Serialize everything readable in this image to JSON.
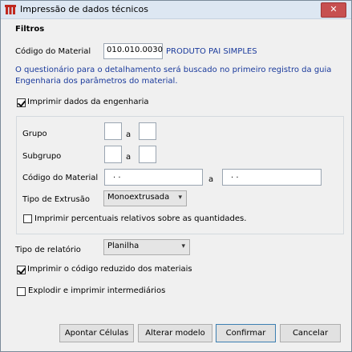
{
  "window": {
    "title": "Impressão de dados técnicos",
    "close_glyph": "✕"
  },
  "filters": {
    "section_title": "Filtros",
    "material_code_label": "Código do Material",
    "material_code_value": "010.010.0030",
    "material_name": "PRODUTO PAI SIMPLES",
    "info_line1": "O questionário para o detalhamento será buscado no primeiro registro da guia",
    "info_line2": "Engenharia dos parâmetros do material.",
    "print_engineering_label": "Imprimir dados da engenharia",
    "print_engineering_checked": true
  },
  "engineering": {
    "group_label": "Grupo",
    "group_from": "",
    "group_to": "",
    "subgroup_label": "Subgrupo",
    "subgroup_from": "",
    "subgroup_to": "",
    "range_sep": "a",
    "material_range_label": "Código do Material",
    "material_from": " .   .",
    "material_to": " .   .",
    "extrusion_label": "Tipo de Extrusão",
    "extrusion_value": "Monoextrusada",
    "percent_label": "Imprimir percentuais relativos sobre as quantidades.",
    "percent_checked": false
  },
  "report": {
    "type_label": "Tipo de relatório",
    "type_value": "Planilha",
    "reduced_code_label": "Imprimir o código reduzido dos materiais",
    "reduced_code_checked": true,
    "explode_label": "Explodir e imprimir intermediários",
    "explode_checked": false
  },
  "buttons": {
    "point_cells": "Apontar Células",
    "change_model": "Alterar modelo",
    "confirm": "Confirmar",
    "cancel": "Cancelar"
  },
  "icons": {
    "app": "app-logo-icon",
    "close": "close-icon",
    "dropdown": "chevron-down-icon",
    "check": "check-icon"
  },
  "colors": {
    "title_bar": "#dde7f2",
    "close_button": "#c75050",
    "info_text": "#1a3a9c",
    "dialog_bg": "#f0f0f0"
  }
}
